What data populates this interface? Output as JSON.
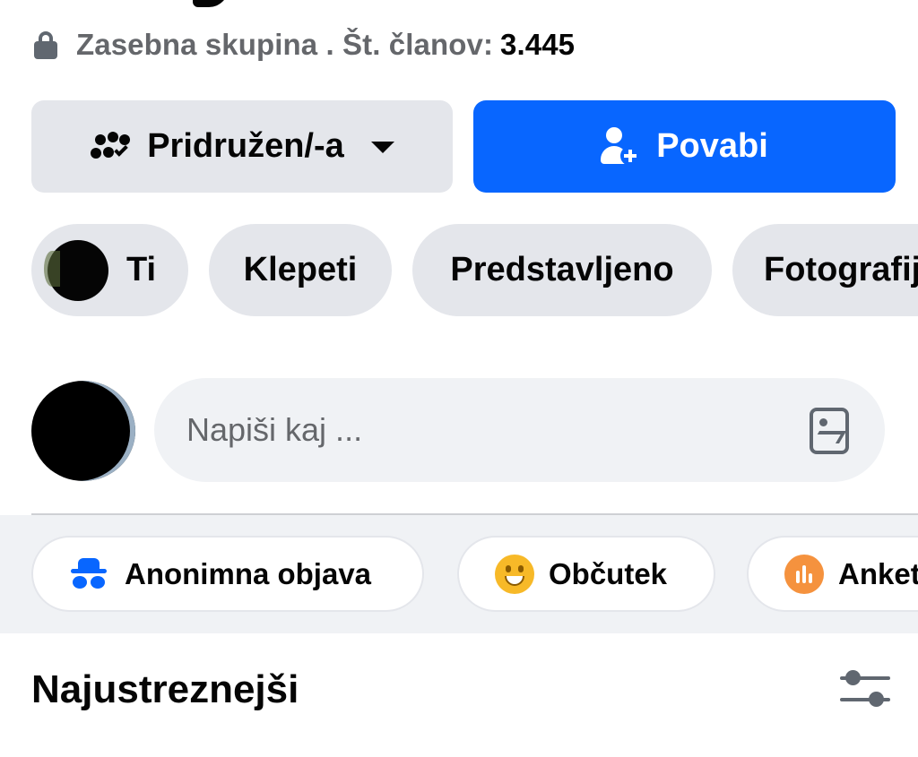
{
  "group": {
    "privacy_label": "Zasebna skupina . Št. članov:",
    "member_count": "3.445"
  },
  "actions": {
    "joined_label": "Pridružen/-a",
    "invite_label": "Povabi"
  },
  "chips": [
    {
      "label": "Ti"
    },
    {
      "label": "Klepeti"
    },
    {
      "label": "Predstavljeno"
    },
    {
      "label": "Fotografij"
    }
  ],
  "composer": {
    "placeholder": "Napiši kaj ..."
  },
  "shortcuts": [
    {
      "label": "Anonimna objava",
      "icon": "incognito-icon"
    },
    {
      "label": "Občutek",
      "icon": "smiley-icon"
    },
    {
      "label": "Anket",
      "icon": "poll-icon"
    }
  ],
  "feed": {
    "sort_label": "Najustreznejši"
  },
  "colors": {
    "primary": "#0866ff",
    "chip_bg": "#e4e6eb",
    "muted_text": "#65676b",
    "feeling": "#f7b928",
    "poll": "#f5923e"
  }
}
